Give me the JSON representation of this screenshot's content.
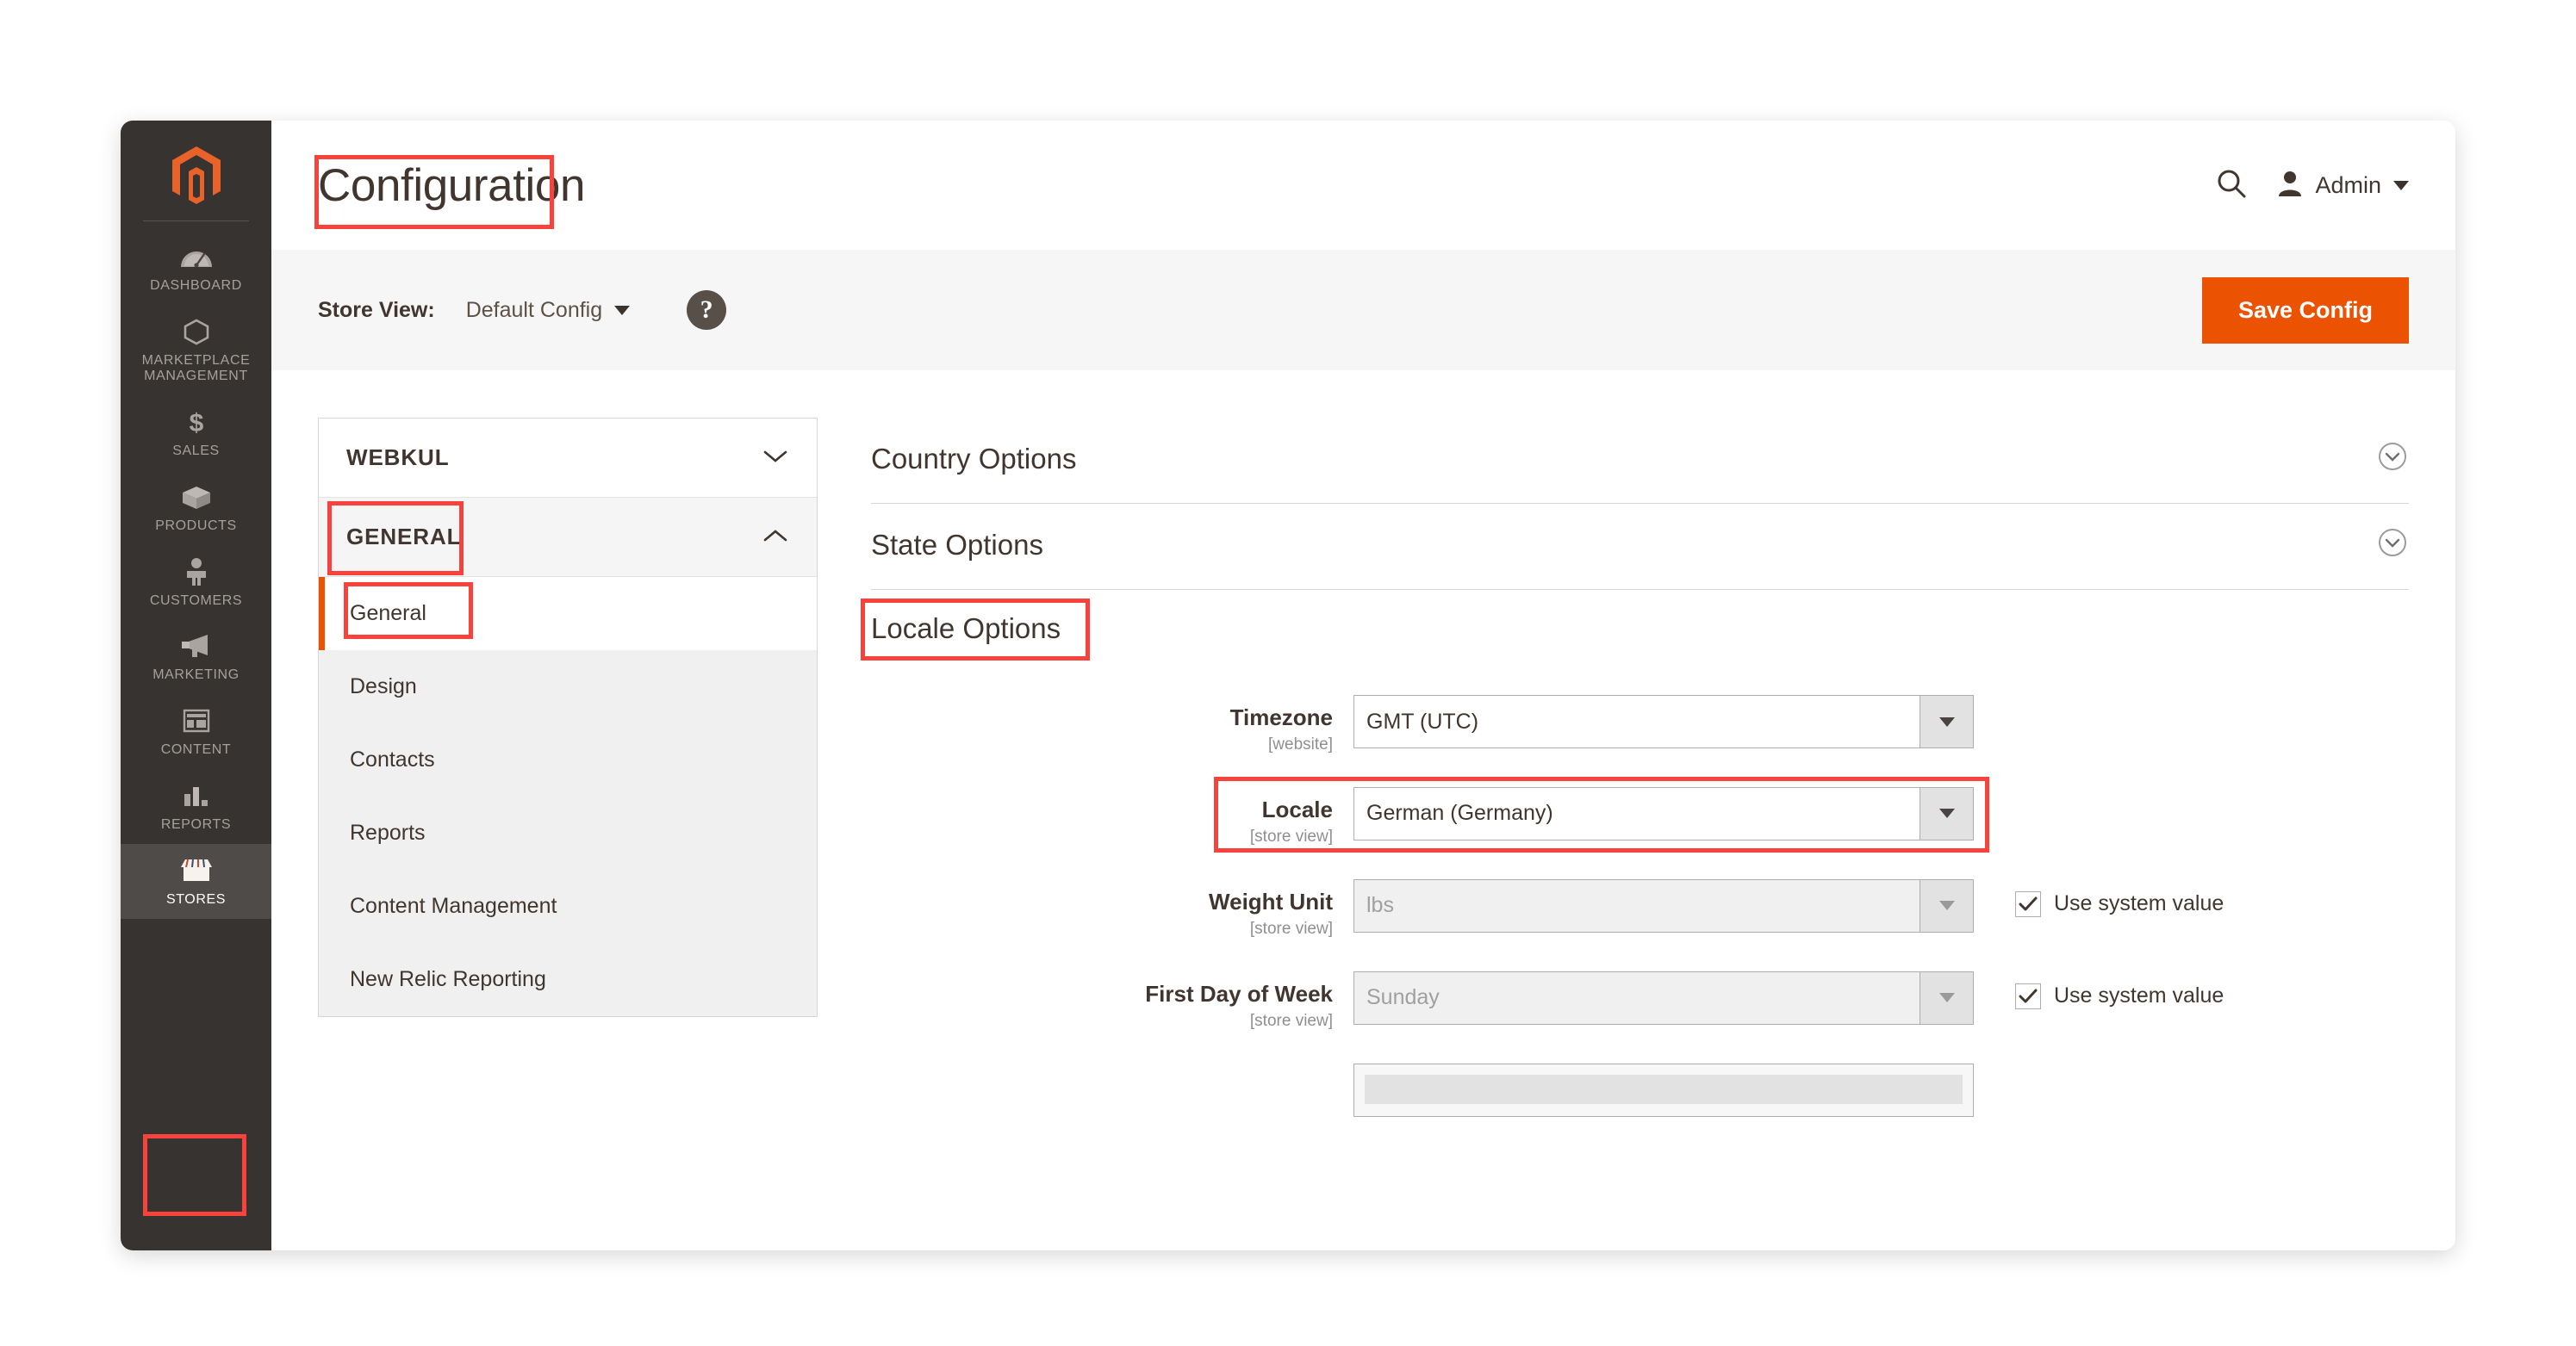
{
  "header": {
    "title": "Configuration",
    "search_icon": "search-icon",
    "user_icon": "user-avatar-icon",
    "user_name": "Admin",
    "user_caret": "chevron-down-icon"
  },
  "storeview_bar": {
    "label": "Store View:",
    "value": "Default Config",
    "caret_icon": "chevron-down-icon",
    "help_icon": "question-mark-icon",
    "help_glyph": "?",
    "save_button": "Save Config"
  },
  "admin_sidebar": {
    "logo": "magento-logo-icon",
    "items": [
      {
        "label": "DASHBOARD",
        "icon": "dashboard-gauge-icon",
        "active": false
      },
      {
        "label": "MARKETPLACE\nMANAGEMENT",
        "icon": "marketplace-hexagon-icon",
        "active": false
      },
      {
        "label": "SALES",
        "icon": "sales-dollar-icon",
        "active": false
      },
      {
        "label": "PRODUCTS",
        "icon": "products-box-icon",
        "active": false
      },
      {
        "label": "CUSTOMERS",
        "icon": "customers-person-icon",
        "active": false
      },
      {
        "label": "MARKETING",
        "icon": "marketing-megaphone-icon",
        "active": false
      },
      {
        "label": "CONTENT",
        "icon": "content-layout-icon",
        "active": false
      },
      {
        "label": "REPORTS",
        "icon": "reports-barchart-icon",
        "active": false
      },
      {
        "label": "STORES",
        "icon": "stores-shop-icon",
        "active": true
      }
    ]
  },
  "config_nav": {
    "groups": [
      {
        "label": "WEBKUL",
        "expanded": false,
        "chevron": "chevron-down-icon"
      },
      {
        "label": "GENERAL",
        "expanded": true,
        "chevron": "chevron-up-icon"
      }
    ],
    "sub_items": [
      {
        "label": "General",
        "active": true
      },
      {
        "label": "Design",
        "active": false
      },
      {
        "label": "Contacts",
        "active": false
      },
      {
        "label": "Reports",
        "active": false
      },
      {
        "label": "Content Management",
        "active": false
      },
      {
        "label": "New Relic Reporting",
        "active": false
      }
    ]
  },
  "config_main": {
    "sections": [
      {
        "title": "Country Options",
        "collapsed": true,
        "chevron": "circle-chevron-down-icon"
      },
      {
        "title": "State Options",
        "collapsed": true,
        "chevron": "circle-chevron-down-icon"
      },
      {
        "title": "Locale Options",
        "collapsed": false,
        "chevron": ""
      }
    ],
    "locale_fields": [
      {
        "label": "Timezone",
        "scope": "[website]",
        "value": "GMT (UTC)",
        "disabled": false,
        "use_system_value": null
      },
      {
        "label": "Locale",
        "scope": "[store view]",
        "value": "German (Germany)",
        "disabled": false,
        "use_system_value": null
      },
      {
        "label": "Weight Unit",
        "scope": "[store view]",
        "value": "lbs",
        "disabled": true,
        "use_system_value": "Use system value"
      },
      {
        "label": "First Day of Week",
        "scope": "[store view]",
        "value": "Sunday",
        "disabled": true,
        "use_system_value": "Use system value"
      }
    ]
  },
  "annotations": {
    "accent_color": "#F8423C",
    "boxes": [
      "page-title",
      "sidebar-item-stores",
      "config-group-general",
      "config-sub-item-general",
      "section-locale-options",
      "field-locale"
    ]
  },
  "colors": {
    "brand_orange": "#EB5202",
    "sidebar_dark": "#373330",
    "sidebar_active": "#4F4B48",
    "text_dark": "#41362F",
    "annotation_red": "#F8423C"
  }
}
